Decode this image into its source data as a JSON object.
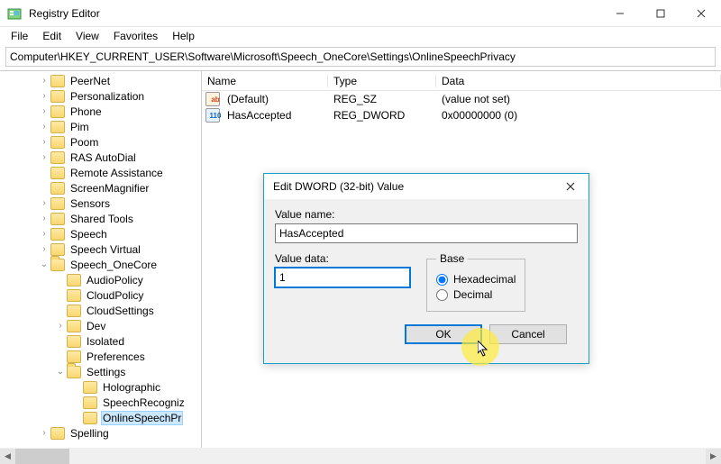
{
  "window": {
    "title": "Registry Editor"
  },
  "menu": {
    "items": [
      "File",
      "Edit",
      "View",
      "Favorites",
      "Help"
    ]
  },
  "address": {
    "path": "Computer\\HKEY_CURRENT_USER\\Software\\Microsoft\\Speech_OneCore\\Settings\\OnlineSpeechPrivacy"
  },
  "tree": {
    "items": [
      {
        "label": "PeerNet",
        "depth": 2,
        "chevron": ">"
      },
      {
        "label": "Personalization",
        "depth": 2,
        "chevron": ">"
      },
      {
        "label": "Phone",
        "depth": 2,
        "chevron": ">"
      },
      {
        "label": "Pim",
        "depth": 2,
        "chevron": ">"
      },
      {
        "label": "Poom",
        "depth": 2,
        "chevron": ">"
      },
      {
        "label": "RAS AutoDial",
        "depth": 2,
        "chevron": ">"
      },
      {
        "label": "Remote Assistance",
        "depth": 2,
        "chevron": ""
      },
      {
        "label": "ScreenMagnifier",
        "depth": 2,
        "chevron": ""
      },
      {
        "label": "Sensors",
        "depth": 2,
        "chevron": ">"
      },
      {
        "label": "Shared Tools",
        "depth": 2,
        "chevron": ">"
      },
      {
        "label": "Speech",
        "depth": 2,
        "chevron": ">"
      },
      {
        "label": "Speech Virtual",
        "depth": 2,
        "chevron": ">"
      },
      {
        "label": "Speech_OneCore",
        "depth": 2,
        "chevron": "v",
        "open": true
      },
      {
        "label": "AudioPolicy",
        "depth": 3,
        "chevron": ""
      },
      {
        "label": "CloudPolicy",
        "depth": 3,
        "chevron": ""
      },
      {
        "label": "CloudSettings",
        "depth": 3,
        "chevron": ""
      },
      {
        "label": "Dev",
        "depth": 3,
        "chevron": ">"
      },
      {
        "label": "Isolated",
        "depth": 3,
        "chevron": ""
      },
      {
        "label": "Preferences",
        "depth": 3,
        "chevron": ""
      },
      {
        "label": "Settings",
        "depth": 3,
        "chevron": "v",
        "open": true
      },
      {
        "label": "Holographic",
        "depth": 4,
        "chevron": ""
      },
      {
        "label": "SpeechRecogniz",
        "depth": 4,
        "chevron": ""
      },
      {
        "label": "OnlineSpeechPr",
        "depth": 4,
        "chevron": "",
        "selected": true
      },
      {
        "label": "Spelling",
        "depth": 2,
        "chevron": ">"
      }
    ]
  },
  "values": {
    "headers": {
      "name": "Name",
      "type": "Type",
      "data": "Data"
    },
    "rows": [
      {
        "icon": "ab",
        "name": "(Default)",
        "type": "REG_SZ",
        "data": "(value not set)"
      },
      {
        "icon": "bin",
        "name": "HasAccepted",
        "type": "REG_DWORD",
        "data": "0x00000000 (0)"
      }
    ]
  },
  "dialog": {
    "title": "Edit DWORD (32-bit) Value",
    "valueNameLabel": "Value name:",
    "valueName": "HasAccepted",
    "valueDataLabel": "Value data:",
    "valueData": "1",
    "baseLabel": "Base",
    "hexadecimal": "Hexadecimal",
    "decimal": "Decimal",
    "ok": "OK",
    "cancel": "Cancel"
  }
}
